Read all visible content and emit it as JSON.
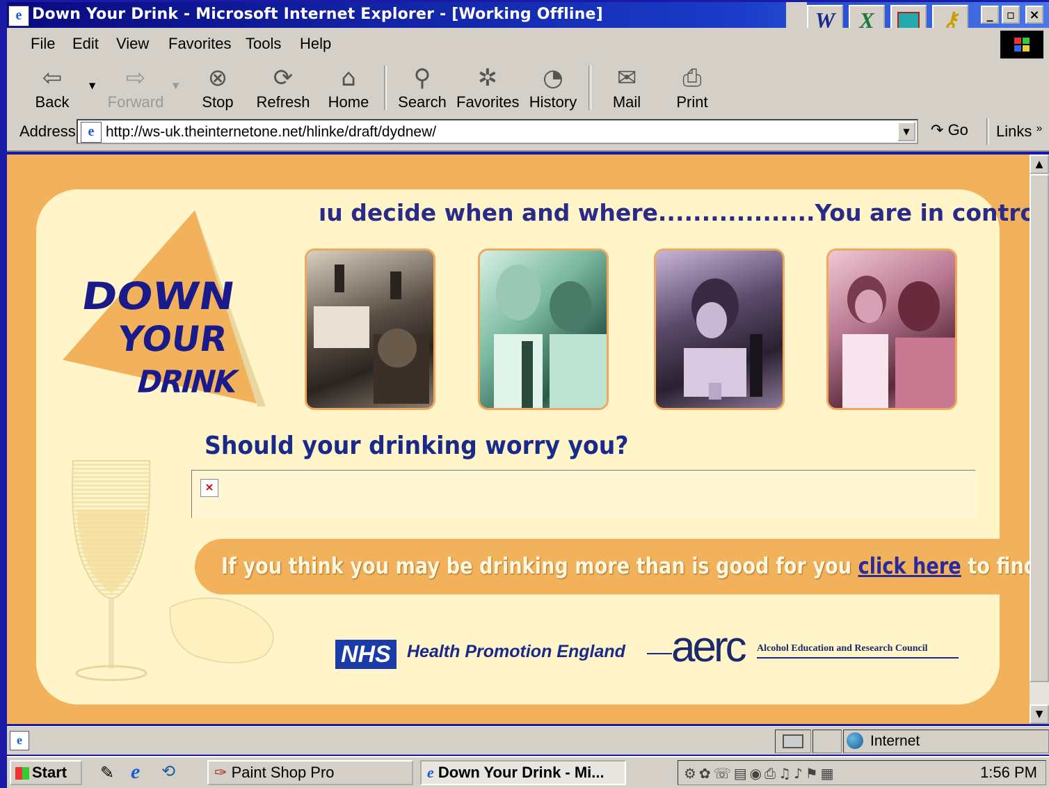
{
  "window": {
    "title": "Down Your Drink - Microsoft Internet Explorer - [Working Offline]",
    "buttons": {
      "minimize": "_",
      "maximize": "▫",
      "close": "×"
    }
  },
  "quicklaunch": [
    "W",
    "X"
  ],
  "menu": [
    "File",
    "Edit",
    "View",
    "Favorites",
    "Tools",
    "Help"
  ],
  "toolbar": {
    "back": "Back",
    "forward": "Forward",
    "stop": "Stop",
    "refresh": "Refresh",
    "home": "Home",
    "search": "Search",
    "favorites": "Favorites",
    "history": "History",
    "mail": "Mail",
    "print": "Print"
  },
  "address": {
    "label": "Address",
    "url": "http://ws-uk.theinternetone.net/hlinke/draft/dydnew/",
    "go": "Go",
    "links": "Links"
  },
  "page": {
    "tagline": "ıu decide when and where..................You are in contro",
    "logo": [
      "DOWN",
      "YOUR",
      "DRINK"
    ],
    "question": "Should your drinking worry you?",
    "banner_pre": "If you think you may be drinking more than is good for you ",
    "banner_link": "click here",
    "banner_post": " to find out",
    "sponsor_nhs": "NHS",
    "sponsor_hpe": "Health Promotion England",
    "sponsor_aerc": "aerc",
    "sponsor_aerc_full": "Alcohol Education and Research Council"
  },
  "status": {
    "zone": "Internet"
  },
  "taskbar": {
    "start": "Start",
    "tasks": [
      "Paint Shop Pro",
      "Down Your Drink - Mi..."
    ],
    "clock": "1:56 PM"
  }
}
